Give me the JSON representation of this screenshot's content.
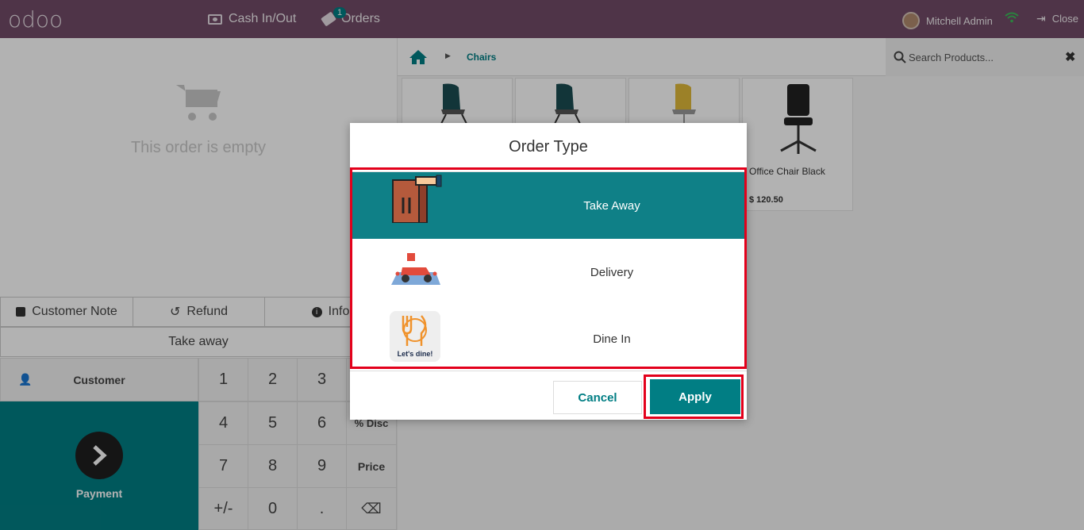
{
  "topbar": {
    "logo": "odoo",
    "cash_in_out": "Cash In/Out",
    "orders": "Orders",
    "orders_badge": "1",
    "user": "Mitchell Admin",
    "close": "Close"
  },
  "order": {
    "empty_text": "This order is empty",
    "customer_note": "Customer Note",
    "refund": "Refund",
    "info": "Info",
    "take_away": "Take away",
    "customer": "Customer",
    "payment": "Payment"
  },
  "numpad": {
    "keys": [
      "1",
      "2",
      "3",
      "4",
      "5",
      "6",
      "% Disc",
      "7",
      "8",
      "9",
      "Price",
      "+/-",
      "0",
      "."
    ]
  },
  "products": {
    "breadcrumb": "Chairs",
    "search_placeholder": "Search Products...",
    "items": [
      {
        "name": "",
        "price": ""
      },
      {
        "name": "",
        "price": ""
      },
      {
        "name": "",
        "price": ""
      },
      {
        "name": "Office Chair Black",
        "price": "$ 120.50"
      }
    ]
  },
  "modal": {
    "title": "Order Type",
    "options": [
      "Take Away",
      "Delivery",
      "Dine In"
    ],
    "dine_caption": "Let's dine!",
    "cancel": "Cancel",
    "apply": "Apply",
    "selected": "Take Away"
  },
  "colors": {
    "topbar": "#714b67",
    "accent": "#017e84",
    "highlight": "#e3001b"
  }
}
